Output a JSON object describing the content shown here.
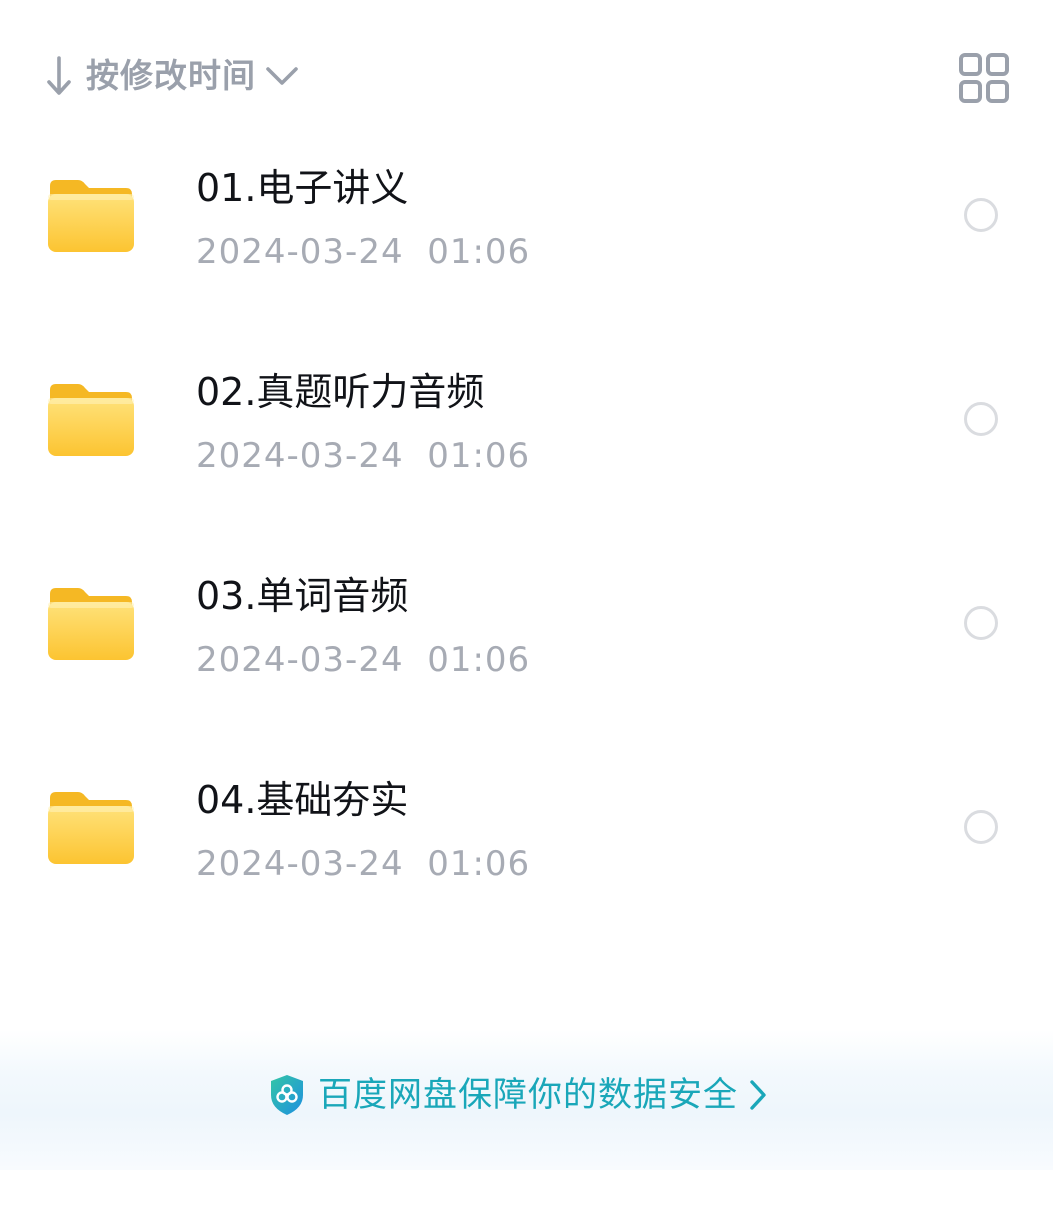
{
  "toolbar": {
    "sort_icon": "arrow-down-icon",
    "sort_label": "按修改时间",
    "sort_chevron_icon": "chevron-down-icon",
    "view_toggle_icon": "grid-view-icon",
    "icon_color": "#9aa0ab"
  },
  "files": [
    {
      "name": "01.电子讲义",
      "modified": "2024-03-24  01:06",
      "icon": "folder-icon",
      "selected": false
    },
    {
      "name": "02.真题听力音频",
      "modified": "2024-03-24  01:06",
      "icon": "folder-icon",
      "selected": false
    },
    {
      "name": "03.单词音频",
      "modified": "2024-03-24  01:06",
      "icon": "folder-icon",
      "selected": false
    },
    {
      "name": "04.基础夯实",
      "modified": "2024-03-24  01:06",
      "icon": "folder-icon",
      "selected": false
    }
  ],
  "footer": {
    "icon": "shield-icon",
    "text": "百度网盘保障你的数据安全",
    "chevron_icon": "chevron-right-icon",
    "text_color": "#1aa7b9"
  },
  "colors": {
    "folder_top": "#ffd95c",
    "folder_bottom": "#fcc431",
    "primary_text": "#111318",
    "secondary_text": "#a7abb4"
  }
}
